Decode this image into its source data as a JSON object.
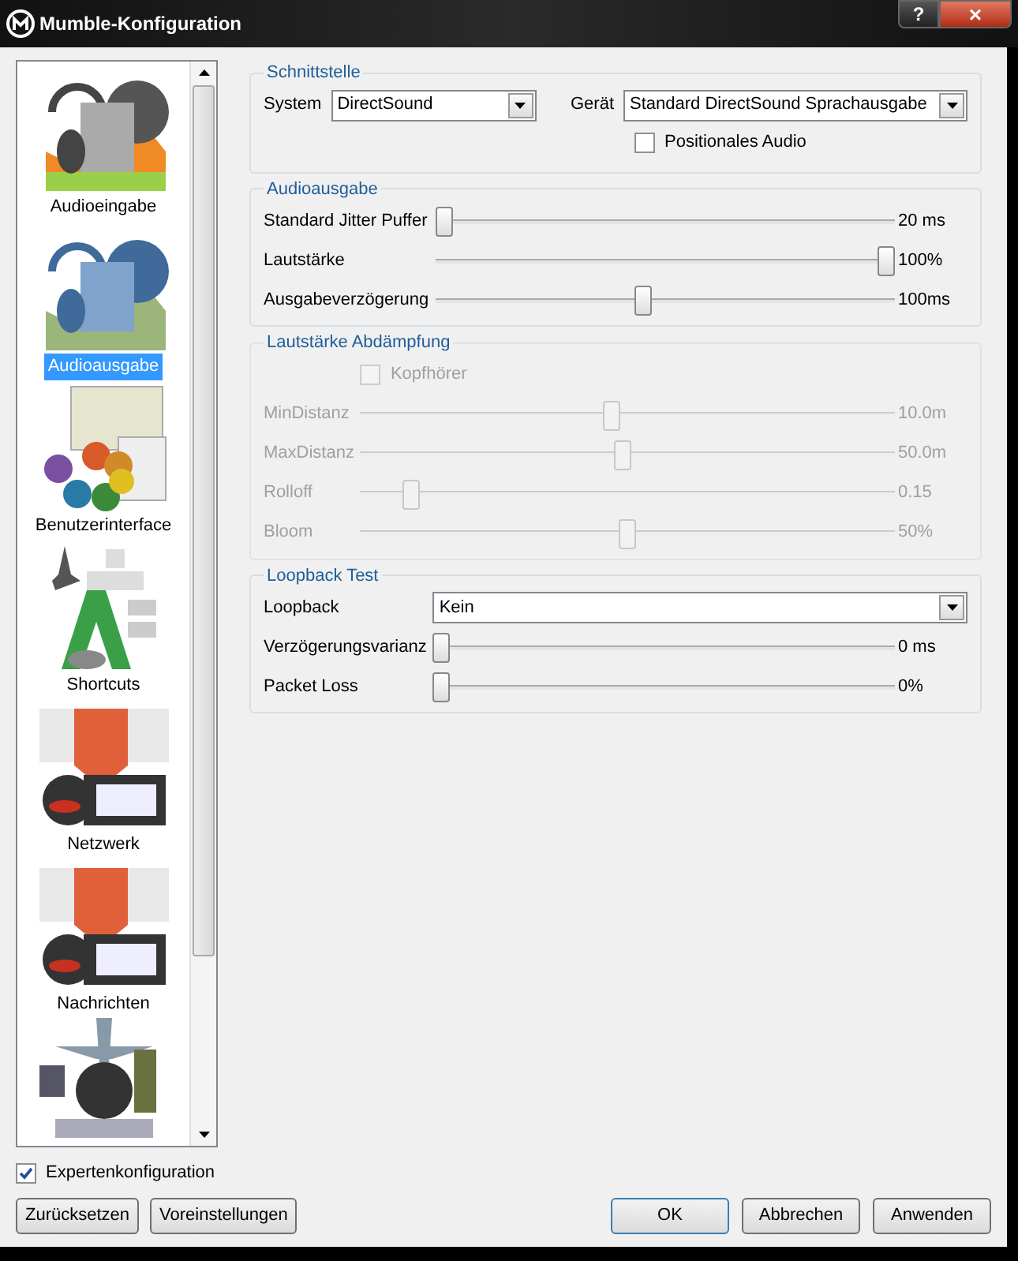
{
  "window": {
    "title": "Mumble-Konfiguration",
    "help": "?",
    "close": "×"
  },
  "sidebar": {
    "items": [
      {
        "label": "Audioeingabe",
        "selected": false
      },
      {
        "label": "Audioausgabe",
        "selected": true
      },
      {
        "label": "Benutzerinterface",
        "selected": false
      },
      {
        "label": "Shortcuts",
        "selected": false
      },
      {
        "label": "Netzwerk",
        "selected": false
      },
      {
        "label": "Nachrichten",
        "selected": false
      }
    ]
  },
  "groups": [
    {
      "title": "Schnittstelle",
      "disabled": false,
      "rows": [
        {
          "kind": "combo-pair",
          "label": "System",
          "value": "DirectSound",
          "label2": "Gerät",
          "value2": "Standard DirectSound Sprachausgabe"
        },
        {
          "kind": "checkbox",
          "label": "Positionales Audio",
          "checked": false
        }
      ]
    },
    {
      "title": "Audioausgabe",
      "disabled": false,
      "rows": [
        {
          "kind": "slider",
          "label": "Standard Jitter Puffer",
          "level": 0,
          "reading": "20 ms"
        },
        {
          "kind": "slider",
          "label": "Lautstärke",
          "level": 1,
          "reading": "100%"
        },
        {
          "kind": "slider",
          "label": "Ausgabeverzögerung",
          "level": 0.45,
          "reading": "100ms"
        }
      ]
    },
    {
      "title": "Lautstärke Abdämpfung",
      "disabled": true,
      "rows": [
        {
          "kind": "checkbox",
          "label": "Kopfhörer",
          "checked": false
        },
        {
          "kind": "slider",
          "label": "MinDistanz",
          "level": 0.47,
          "reading": "10.0m"
        },
        {
          "kind": "slider",
          "label": "MaxDistanz",
          "level": 0.49,
          "reading": "50.0m"
        },
        {
          "kind": "slider",
          "label": "Rolloff",
          "level": 0.08,
          "reading": "0.15"
        },
        {
          "kind": "slider",
          "label": "Bloom",
          "level": 0.5,
          "reading": "50%"
        }
      ]
    },
    {
      "title": "Loopback Test",
      "disabled": false,
      "rows": [
        {
          "kind": "combo",
          "label": "Loopback",
          "value": "Kein"
        },
        {
          "kind": "slider",
          "label": "Verzögerungsvarianz",
          "level": 0,
          "reading": "0 ms"
        },
        {
          "kind": "slider",
          "label": "Packet Loss",
          "level": 0,
          "reading": "0%"
        }
      ]
    }
  ],
  "expert": {
    "label": "Expertenkonfiguration",
    "checked": true
  },
  "buttons_left": [
    "Zurücksetzen",
    "Voreinstellungen"
  ],
  "buttons_right": [
    {
      "label": "OK",
      "default": true
    },
    {
      "label": "Abbrechen",
      "default": false
    },
    {
      "label": "Anwenden",
      "default": false
    }
  ]
}
